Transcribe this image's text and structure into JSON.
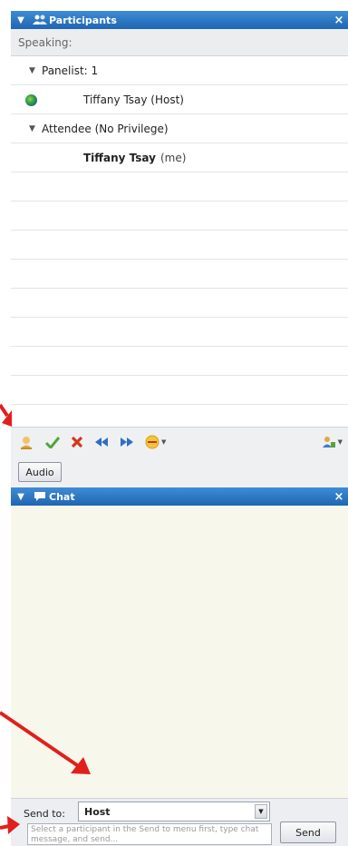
{
  "participants_panel": {
    "title": "Participants",
    "close_glyph": "×",
    "speaking_label": "Speaking:",
    "rows": [
      {
        "type": "group",
        "label": "Panelist: 1"
      },
      {
        "type": "person",
        "label": "Tiffany Tsay (Host)",
        "icon": "globe-status-icon"
      },
      {
        "type": "group",
        "label": "Attendee (No Privilege)"
      },
      {
        "type": "person-self",
        "name": "Tiffany Tsay",
        "suffix": "(me)"
      }
    ],
    "toolbar_icons": [
      "raise-hand-icon",
      "check-icon",
      "cross-icon",
      "rewind-icon",
      "fast-forward-icon",
      "emoticon-icon",
      "assign-privileges-icon"
    ],
    "audio_label": "Audio"
  },
  "chat_panel": {
    "title": "Chat",
    "close_glyph": "×",
    "send_to_label": "Send to:",
    "send_to_value": "Host",
    "message_placeholder": "Select a participant in the Send to menu first, type chat message, and send...",
    "send_label": "Send"
  },
  "colors": {
    "header_blue": "#2a74c4",
    "annotation_red": "#e0201c",
    "chat_background": "#f7f7ec"
  }
}
